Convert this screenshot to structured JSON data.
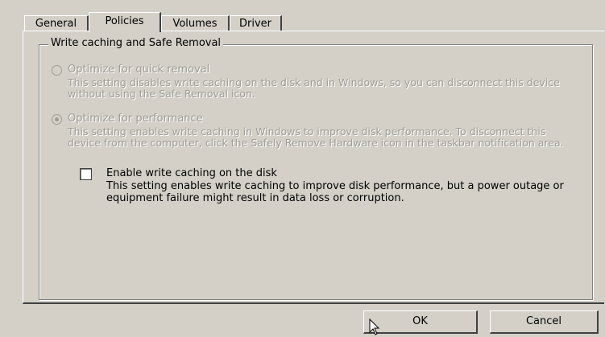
{
  "tabs": [
    {
      "label": "General"
    },
    {
      "label": "Policies",
      "active": true
    },
    {
      "label": "Volumes"
    },
    {
      "label": "Driver"
    }
  ],
  "group": {
    "title": "Write caching and Safe Removal"
  },
  "options": {
    "quick_removal": {
      "label": "Optimize for quick removal",
      "description": "This setting disables write caching on the disk and in Windows, so you can disconnect this device without using the Safe Removal icon.",
      "selected": false,
      "enabled": false
    },
    "performance": {
      "label": "Optimize for performance",
      "description": "This setting enables write caching in Windows to improve disk performance. To disconnect this device from the computer, click the Safely Remove Hardware icon in the taskbar notification area.",
      "selected": true,
      "enabled": false
    }
  },
  "write_cache": {
    "label": "Enable write caching on the disk",
    "description": "This setting enables write caching to improve disk performance, but a power outage or equipment failure might result in data loss or corruption.",
    "checked": false
  },
  "buttons": {
    "ok": "OK",
    "cancel": "Cancel"
  },
  "colors": {
    "face": "#d4d0c8",
    "disabled_text": "#a09c94"
  }
}
